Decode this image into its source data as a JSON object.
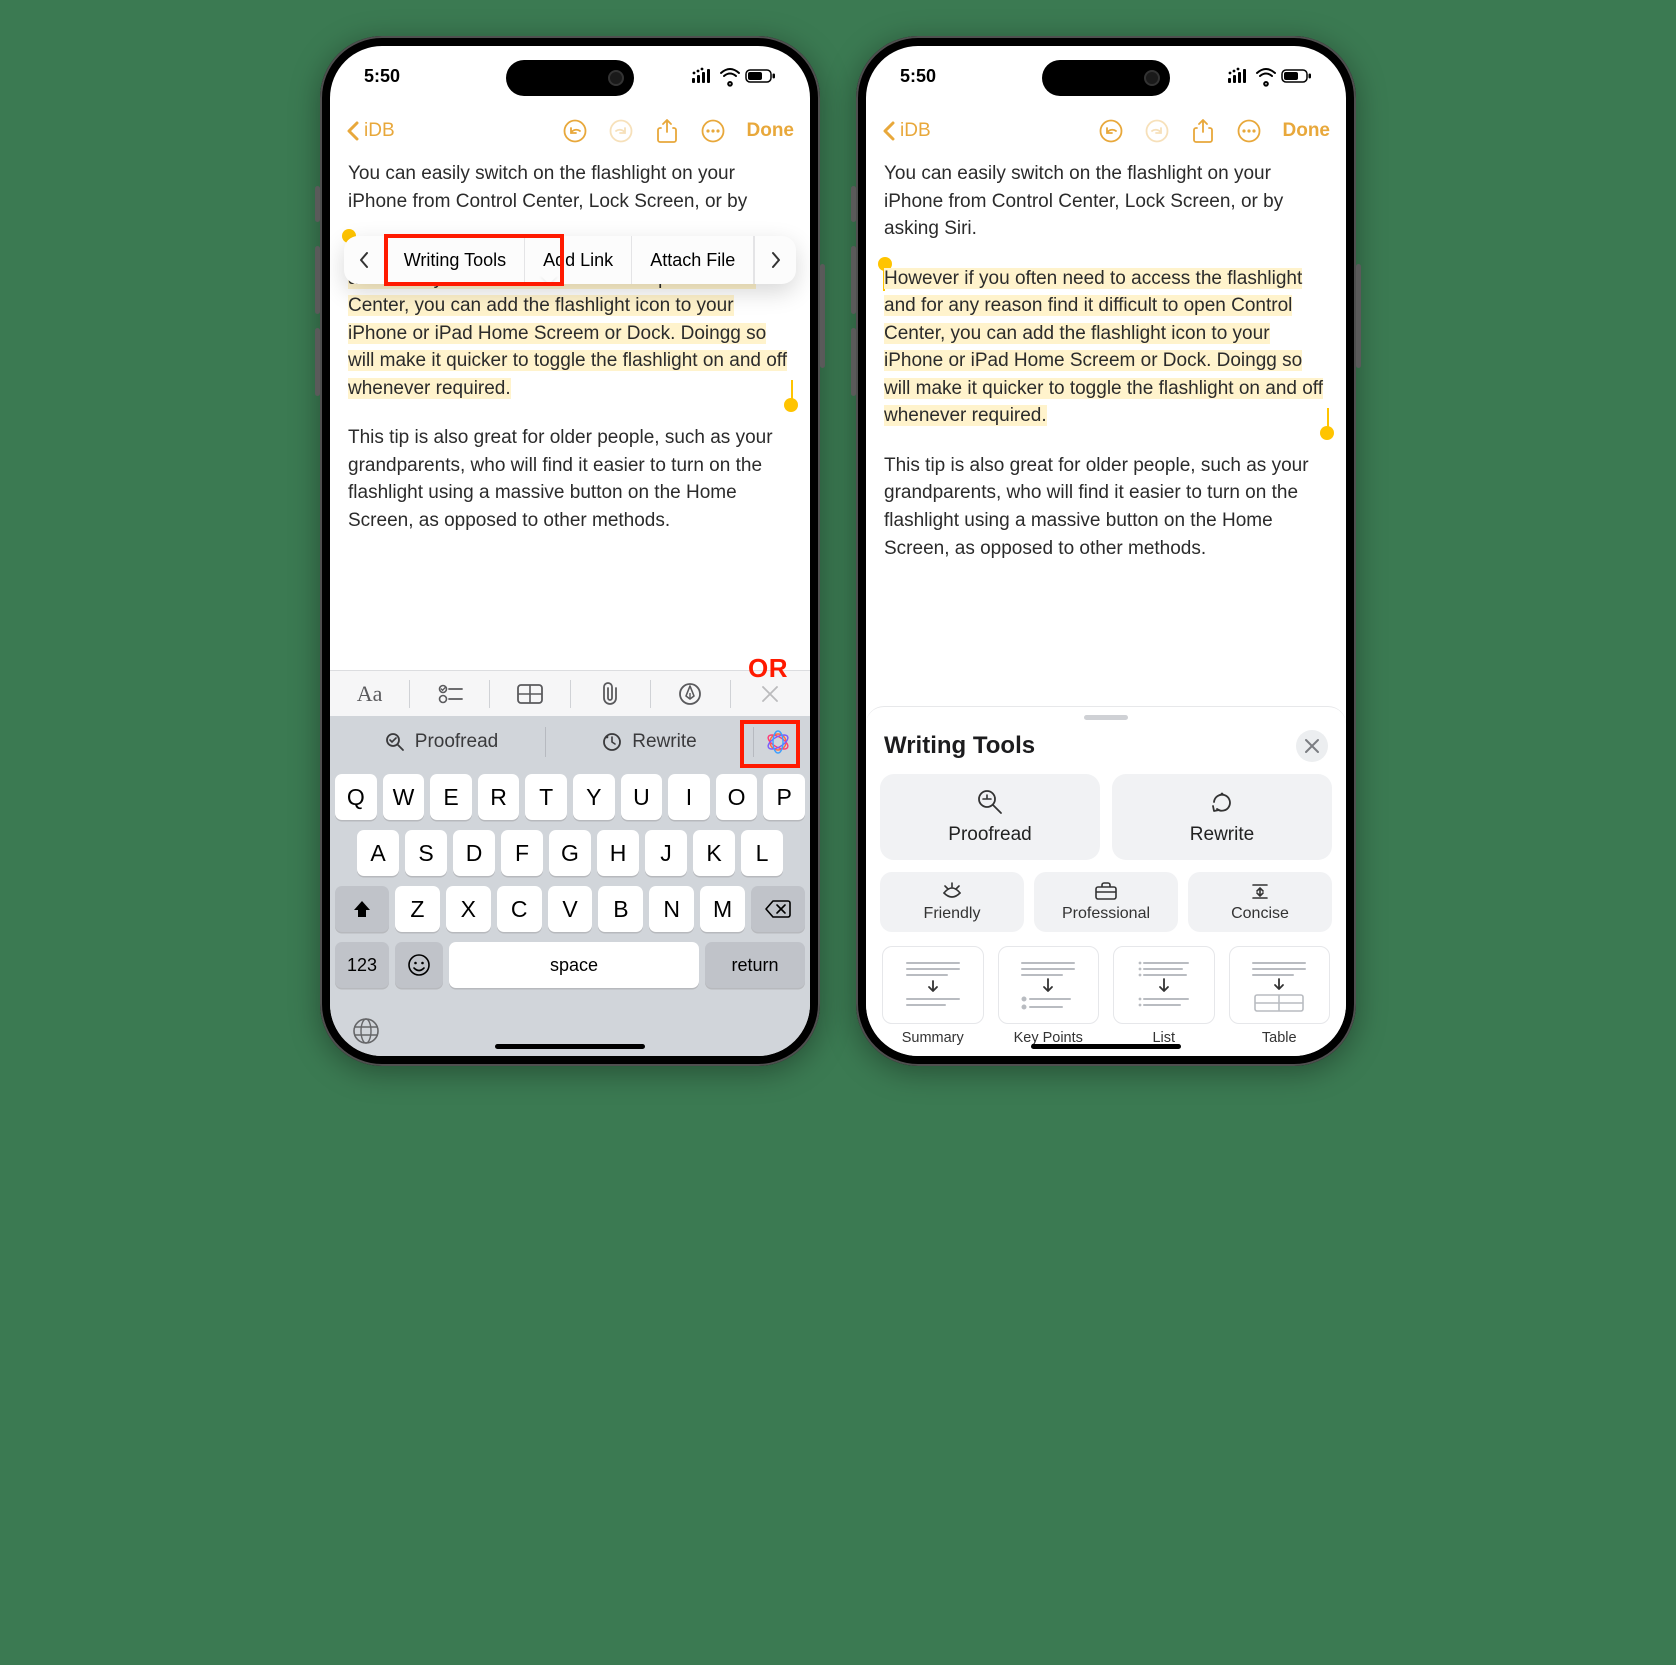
{
  "status": {
    "time": "5:50"
  },
  "nav": {
    "back_label": "iDB",
    "done_label": "Done"
  },
  "note": {
    "p1": "You can easily switch on the flashlight on your iPhone from Control Center, Lock Screen, or by asking Siri.",
    "p1_short": "You can easily switch on the flashlight on your iPhone from Control Center, Lock Screen, or by",
    "highlighted": "However if you often need to access the flashlight and for any reason find it difficult to open Control Center, you can add the flashlight icon to your iPhone or iPad Home Screem or Dock. Doingg so will make it quicker to toggle the flashlight on and off whenever required.",
    "p3": "This tip is also great for older people, such as your grandparents, who will find it easier to turn on the flashlight using a massive button on the Home Screen, as opposed to other methods."
  },
  "context_menu": {
    "items": [
      "Writing Tools",
      "Add Link",
      "Attach File"
    ]
  },
  "or_label": "OR",
  "wt_quick": {
    "proofread": "Proofread",
    "rewrite": "Rewrite"
  },
  "keyboard": {
    "row1": [
      "Q",
      "W",
      "E",
      "R",
      "T",
      "Y",
      "U",
      "I",
      "O",
      "P"
    ],
    "row2": [
      "A",
      "S",
      "D",
      "F",
      "G",
      "H",
      "J",
      "K",
      "L"
    ],
    "row3": [
      "Z",
      "X",
      "C",
      "V",
      "B",
      "N",
      "M"
    ],
    "fn": "123",
    "space": "space",
    "return": "return"
  },
  "sheet": {
    "title": "Writing Tools",
    "big": {
      "proofread": "Proofread",
      "rewrite": "Rewrite"
    },
    "tones": {
      "friendly": "Friendly",
      "professional": "Professional",
      "concise": "Concise"
    },
    "transforms": {
      "summary": "Summary",
      "keypoints": "Key Points",
      "list": "List",
      "table": "Table"
    }
  }
}
